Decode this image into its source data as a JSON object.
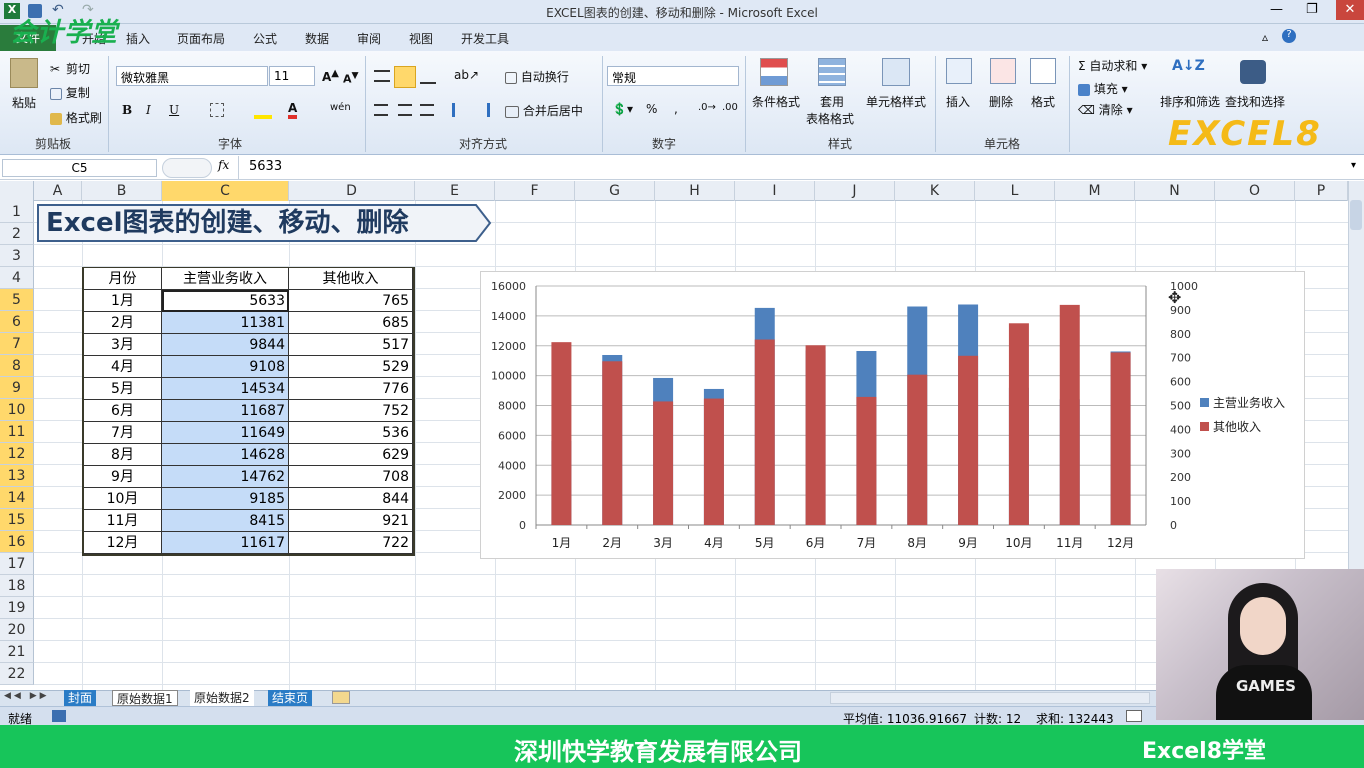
{
  "window": {
    "title": "EXCEL图表的创建、移动和删除 - Microsoft Excel"
  },
  "ribbon_tabs": [
    "文件",
    "开始",
    "插入",
    "页面布局",
    "公式",
    "数据",
    "审阅",
    "视图",
    "开发工具"
  ],
  "clipboard": {
    "paste": "粘贴",
    "cut": "剪切",
    "copy": "复制",
    "format_painter": "格式刷",
    "group": "剪贴板"
  },
  "font": {
    "name": "微软雅黑",
    "size": "11",
    "group": "字体"
  },
  "alignment": {
    "wrap": "自动换行",
    "merge": "合并后居中",
    "group": "对齐方式"
  },
  "number": {
    "format": "常规",
    "group": "数字"
  },
  "styles": {
    "cond": "条件格式",
    "table1": "套用",
    "table2": "表格格式",
    "cell": "单元格样式",
    "group": "样式"
  },
  "cells": {
    "insert": "插入",
    "delete": "删除",
    "format": "格式",
    "group": "单元格"
  },
  "editing": {
    "autosum": "自动求和",
    "fill": "填充",
    "clear": "清除",
    "sort": "排序和筛选",
    "find": "查找和选择"
  },
  "watermark_logo": "EXCEL8",
  "formula_bar": {
    "name_box": "C5",
    "fx": "fx",
    "value": "5633"
  },
  "columns": [
    "A",
    "B",
    "C",
    "D",
    "E",
    "F",
    "G",
    "H",
    "I",
    "J",
    "K",
    "L",
    "M",
    "N",
    "O",
    "P"
  ],
  "rows": [
    "1",
    "2",
    "3",
    "4",
    "5",
    "6",
    "7",
    "8",
    "9",
    "10",
    "11",
    "12",
    "13",
    "14",
    "15",
    "16",
    "17",
    "18",
    "19",
    "20",
    "21",
    "22"
  ],
  "banner": {
    "text": "Excel图表的创建、移动、删除"
  },
  "table": {
    "headers": [
      "月份",
      "主营业务收入",
      "其他收入"
    ],
    "rows": [
      [
        "1月",
        "5633",
        "765"
      ],
      [
        "2月",
        "11381",
        "685"
      ],
      [
        "3月",
        "9844",
        "517"
      ],
      [
        "4月",
        "9108",
        "529"
      ],
      [
        "5月",
        "14534",
        "776"
      ],
      [
        "6月",
        "11687",
        "752"
      ],
      [
        "7月",
        "11649",
        "536"
      ],
      [
        "8月",
        "14628",
        "629"
      ],
      [
        "9月",
        "14762",
        "708"
      ],
      [
        "10月",
        "9185",
        "844"
      ],
      [
        "11月",
        "8415",
        "921"
      ],
      [
        "12月",
        "11617",
        "722"
      ]
    ]
  },
  "chart_data": {
    "type": "bar",
    "categories": [
      "1月",
      "2月",
      "3月",
      "4月",
      "5月",
      "6月",
      "7月",
      "8月",
      "9月",
      "10月",
      "11月",
      "12月"
    ],
    "series": [
      {
        "name": "主营业务收入",
        "axis": "left",
        "color": "#4f81bd",
        "values": [
          5633,
          11381,
          9844,
          9108,
          14534,
          11687,
          11649,
          14628,
          14762,
          9185,
          8415,
          11617
        ]
      },
      {
        "name": "其他收入",
        "axis": "right",
        "color": "#c0504d",
        "values": [
          765,
          685,
          517,
          529,
          776,
          752,
          536,
          629,
          708,
          844,
          921,
          722
        ]
      }
    ],
    "y_left": {
      "range": [
        0,
        16000
      ],
      "ticks": [
        "0",
        "2000",
        "4000",
        "6000",
        "8000",
        "10000",
        "12000",
        "14000",
        "16000"
      ]
    },
    "y_right": {
      "range": [
        0,
        1000
      ],
      "ticks": [
        "0",
        "100",
        "200",
        "300",
        "400",
        "500",
        "600",
        "700",
        "800",
        "900",
        "1000"
      ]
    },
    "legend": "right",
    "grid": true
  },
  "sheet_tabs": [
    "封面",
    "原始数据1",
    "原始数据2",
    "结束页"
  ],
  "status": {
    "ready": "就绪",
    "avg": "平均值: 11036.91667",
    "count": "计数: 12",
    "sum": "求和: 132443"
  },
  "footer": {
    "company": "深圳快学教育发展有限公司",
    "brand": "Excel8学堂"
  },
  "overlay_logo": "会计学堂",
  "webcam_shirt": "GAMES"
}
